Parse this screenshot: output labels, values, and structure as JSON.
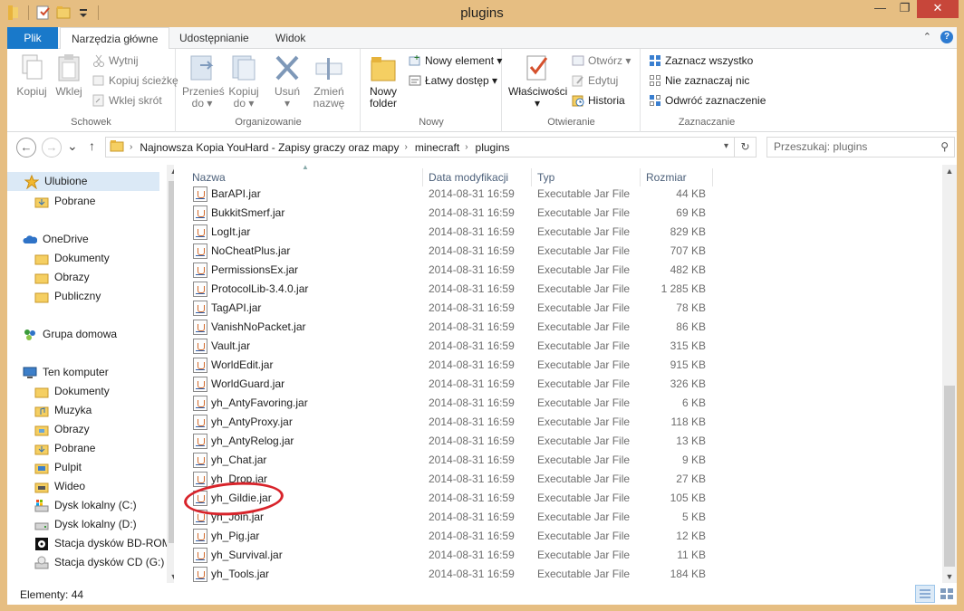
{
  "window": {
    "title": "plugins"
  },
  "tabs": [
    {
      "label": "Plik"
    },
    {
      "label": "Narzędzia główne"
    },
    {
      "label": "Udostępnianie"
    },
    {
      "label": "Widok"
    }
  ],
  "ribbon": {
    "schowek": {
      "label": "Schowek",
      "kopiuj": "Kopiuj",
      "wklej": "Wklej",
      "wytnij": "Wytnij",
      "kopiuj_sciezke": "Kopiuj ścieżkę",
      "wklej_skrot": "Wklej skrót"
    },
    "organizowanie": {
      "label": "Organizowanie",
      "przenies_1": "Przenieś",
      "przenies_2": "do ▾",
      "kopiuj_1": "Kopiuj",
      "kopiuj_2": "do ▾",
      "usun_1": "Usuń",
      "usun_2": "▾",
      "zmien_1": "Zmień",
      "zmien_2": "nazwę"
    },
    "nowy": {
      "label": "Nowy",
      "nowy_folder_1": "Nowy",
      "nowy_folder_2": "folder",
      "nowy_element": "Nowy element ▾",
      "latwy_dostep": "Łatwy dostęp ▾"
    },
    "otwieranie": {
      "label": "Otwieranie",
      "wlasciwosci_1": "Właściwości",
      "wlasciwosci_2": "▾",
      "otworz": "Otwórz ▾",
      "edytuj": "Edytuj",
      "historia": "Historia"
    },
    "zaznaczanie": {
      "label": "Zaznaczanie",
      "zaznacz_wszystko": "Zaznacz wszystko",
      "nie_zaznaczaj": "Nie zaznaczaj nic",
      "odwroc": "Odwróć zaznaczenie"
    }
  },
  "address": {
    "crumbs": [
      "Najnowsza Kopia YouHard - Zapisy graczy oraz mapy",
      "minecraft",
      "plugins"
    ],
    "search_placeholder": "Przeszukaj: plugins"
  },
  "nav": {
    "favorites": {
      "label": "Ulubione",
      "items": [
        "Pobrane"
      ]
    },
    "onedrive": {
      "label": "OneDrive",
      "items": [
        "Dokumenty",
        "Obrazy",
        "Publiczny"
      ]
    },
    "homegroup": {
      "label": "Grupa domowa"
    },
    "computer": {
      "label": "Ten komputer",
      "items": [
        "Dokumenty",
        "Muzyka",
        "Obrazy",
        "Pobrane",
        "Pulpit",
        "Wideo",
        "Dysk lokalny (C:)",
        "Dysk lokalny (D:)",
        "Stacja dysków BD-ROM",
        "Stacja dysków CD (G:)"
      ]
    }
  },
  "columns": {
    "name": "Nazwa",
    "date": "Data modyfikacji",
    "type": "Typ",
    "size": "Rozmiar"
  },
  "files": [
    {
      "name": "BarAPI.jar",
      "date": "2014-08-31 16:59",
      "type": "Executable Jar File",
      "size": "44 KB"
    },
    {
      "name": "BukkitSmerf.jar",
      "date": "2014-08-31 16:59",
      "type": "Executable Jar File",
      "size": "69 KB"
    },
    {
      "name": "LogIt.jar",
      "date": "2014-08-31 16:59",
      "type": "Executable Jar File",
      "size": "829 KB"
    },
    {
      "name": "NoCheatPlus.jar",
      "date": "2014-08-31 16:59",
      "type": "Executable Jar File",
      "size": "707 KB"
    },
    {
      "name": "PermissionsEx.jar",
      "date": "2014-08-31 16:59",
      "type": "Executable Jar File",
      "size": "482 KB"
    },
    {
      "name": "ProtocolLib-3.4.0.jar",
      "date": "2014-08-31 16:59",
      "type": "Executable Jar File",
      "size": "1 285 KB"
    },
    {
      "name": "TagAPI.jar",
      "date": "2014-08-31 16:59",
      "type": "Executable Jar File",
      "size": "78 KB"
    },
    {
      "name": "VanishNoPacket.jar",
      "date": "2014-08-31 16:59",
      "type": "Executable Jar File",
      "size": "86 KB"
    },
    {
      "name": "Vault.jar",
      "date": "2014-08-31 16:59",
      "type": "Executable Jar File",
      "size": "315 KB"
    },
    {
      "name": "WorldEdit.jar",
      "date": "2014-08-31 16:59",
      "type": "Executable Jar File",
      "size": "915 KB"
    },
    {
      "name": "WorldGuard.jar",
      "date": "2014-08-31 16:59",
      "type": "Executable Jar File",
      "size": "326 KB"
    },
    {
      "name": "yh_AntyFavoring.jar",
      "date": "2014-08-31 16:59",
      "type": "Executable Jar File",
      "size": "6 KB"
    },
    {
      "name": "yh_AntyProxy.jar",
      "date": "2014-08-31 16:59",
      "type": "Executable Jar File",
      "size": "118 KB"
    },
    {
      "name": "yh_AntyRelog.jar",
      "date": "2014-08-31 16:59",
      "type": "Executable Jar File",
      "size": "13 KB"
    },
    {
      "name": "yh_Chat.jar",
      "date": "2014-08-31 16:59",
      "type": "Executable Jar File",
      "size": "9 KB"
    },
    {
      "name": "yh_Drop.jar",
      "date": "2014-08-31 16:59",
      "type": "Executable Jar File",
      "size": "27 KB"
    },
    {
      "name": "yh_Gildie.jar",
      "date": "2014-08-31 16:59",
      "type": "Executable Jar File",
      "size": "105 KB"
    },
    {
      "name": "yh_Join.jar",
      "date": "2014-08-31 16:59",
      "type": "Executable Jar File",
      "size": "5 KB"
    },
    {
      "name": "yh_Pig.jar",
      "date": "2014-08-31 16:59",
      "type": "Executable Jar File",
      "size": "12 KB"
    },
    {
      "name": "yh_Survival.jar",
      "date": "2014-08-31 16:59",
      "type": "Executable Jar File",
      "size": "11 KB"
    },
    {
      "name": "yh_Tools.jar",
      "date": "2014-08-31 16:59",
      "type": "Executable Jar File",
      "size": "184 KB"
    }
  ],
  "status": {
    "text": "Elementy: 44"
  },
  "colors": {
    "accent": "#1979ca",
    "frame": "#e6be82",
    "annotation": "#d8232a",
    "close": "#c7463a"
  }
}
